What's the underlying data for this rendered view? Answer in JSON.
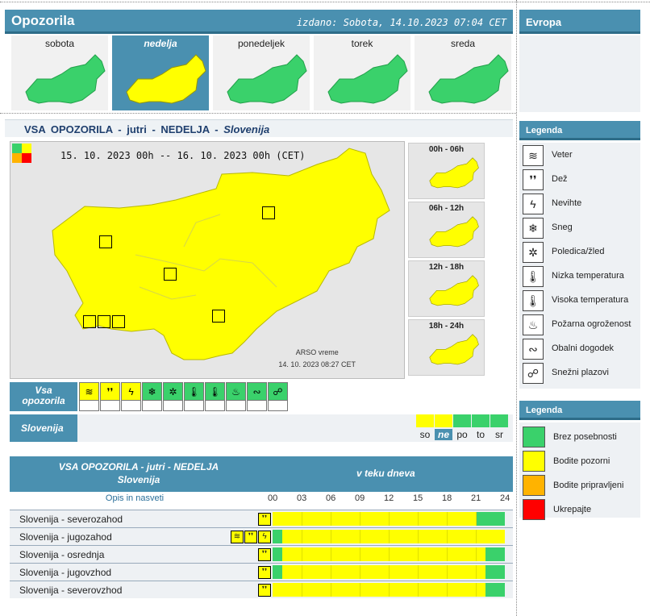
{
  "colors": {
    "green": "#3ad16b",
    "yellow": "#ffff00",
    "orange": "#ffb300",
    "red": "#ff0000",
    "header": "#4a90b0"
  },
  "header": {
    "title": "Opozorila",
    "issued": "izdano: Sobota, 14.10.2023 07:04 CET",
    "europe": "Evropa"
  },
  "days": [
    {
      "label": "sobota",
      "color": "green",
      "selected": false
    },
    {
      "label": "nedelja",
      "color": "yellow",
      "selected": true
    },
    {
      "label": "ponedeljek",
      "color": "green",
      "selected": false
    },
    {
      "label": "torek",
      "color": "green",
      "selected": false
    },
    {
      "label": "sreda",
      "color": "green",
      "selected": false
    }
  ],
  "main": {
    "title": "VSA OPOZORILA  -  jutri  -  NEDELJA  -  Slovenija",
    "title_parts": {
      "a": "VSA OPOZORILA",
      "b": "-",
      "c": "jutri",
      "d": "-",
      "e": "NEDELJA",
      "f": "-",
      "g": "Slovenija"
    },
    "date_range": "15. 10. 2023  00h  --  16. 10. 2023  00h    (CET)",
    "source_name": "ARSO vreme",
    "source_date": "14. 10. 2023   08:27 CET",
    "slots": [
      "00h - 06h",
      "06h - 12h",
      "12h - 18h",
      "18h - 24h"
    ]
  },
  "hazard_row": {
    "label_1": "Vsa",
    "label_2": "opozorila",
    "icons": [
      "wind-icon",
      "rain-icon",
      "thunderstorm-icon",
      "snow-icon",
      "ice-icon",
      "low-temp-icon",
      "high-temp-icon",
      "fire-icon",
      "coastal-icon",
      "avalanche-icon"
    ],
    "icon_colors": [
      "yellow",
      "yellow",
      "yellow",
      "green",
      "green",
      "green",
      "green",
      "green",
      "green",
      "green"
    ]
  },
  "slovenija_row": {
    "label": "Slovenija",
    "days": [
      {
        "abbr": "so",
        "color": "yellow"
      },
      {
        "abbr": "ne",
        "color": "yellow"
      },
      {
        "abbr": "po",
        "color": "green"
      },
      {
        "abbr": "to",
        "color": "green"
      },
      {
        "abbr": "sr",
        "color": "green"
      }
    ]
  },
  "table": {
    "header_1": "VSA OPOZORILA - jutri - NEDELJA",
    "header_2": "Slovenija",
    "header_3": "v teku dneva",
    "opis": "Opis in nasveti",
    "hours": [
      "00",
      "03",
      "06",
      "09",
      "12",
      "15",
      "18",
      "21",
      "24"
    ],
    "rows": [
      {
        "name": "Slovenija - severozahod",
        "segments": [
          {
            "color": "yellow",
            "from": 0,
            "to": 21
          },
          {
            "color": "green",
            "from": 21,
            "to": 24
          }
        ]
      },
      {
        "name": "Slovenija - jugozahod",
        "segments": [
          {
            "color": "green",
            "from": 0,
            "to": 1
          },
          {
            "color": "yellow",
            "from": 1,
            "to": 24
          }
        ]
      },
      {
        "name": "Slovenija - osrednja",
        "segments": [
          {
            "color": "green",
            "from": 0,
            "to": 1
          },
          {
            "color": "yellow",
            "from": 1,
            "to": 22
          },
          {
            "color": "green",
            "from": 22,
            "to": 24
          }
        ]
      },
      {
        "name": "Slovenija - jugovzhod",
        "segments": [
          {
            "color": "green",
            "from": 0,
            "to": 1
          },
          {
            "color": "yellow",
            "from": 1,
            "to": 22
          },
          {
            "color": "green",
            "from": 22,
            "to": 24
          }
        ]
      },
      {
        "name": "Slovenija - severovzhod",
        "segments": [
          {
            "color": "yellow",
            "from": 0,
            "to": 22
          },
          {
            "color": "green",
            "from": 22,
            "to": 24
          }
        ]
      }
    ]
  },
  "legend_hazards": {
    "title": "Legenda",
    "items": [
      {
        "icon": "wind-icon",
        "label": "Veter"
      },
      {
        "icon": "rain-icon",
        "label": "Dež"
      },
      {
        "icon": "thunderstorm-icon",
        "label": "Nevihte"
      },
      {
        "icon": "snow-icon",
        "label": "Sneg"
      },
      {
        "icon": "ice-icon",
        "label": "Poledica/žled"
      },
      {
        "icon": "low-temp-icon",
        "label": "Nizka temperatura"
      },
      {
        "icon": "high-temp-icon",
        "label": "Visoka temperatura"
      },
      {
        "icon": "fire-icon",
        "label": "Požarna ogroženost"
      },
      {
        "icon": "coastal-icon",
        "label": "Obalni dogodek"
      },
      {
        "icon": "avalanche-icon",
        "label": "Snežni plazovi"
      }
    ]
  },
  "legend_levels": {
    "title": "Legenda",
    "items": [
      {
        "color": "green",
        "label": "Brez posebnosti"
      },
      {
        "color": "yellow",
        "label": "Bodite pozorni"
      },
      {
        "color": "orange",
        "label": "Bodite pripravljeni"
      },
      {
        "color": "red",
        "label": "Ukrepajte"
      }
    ]
  }
}
